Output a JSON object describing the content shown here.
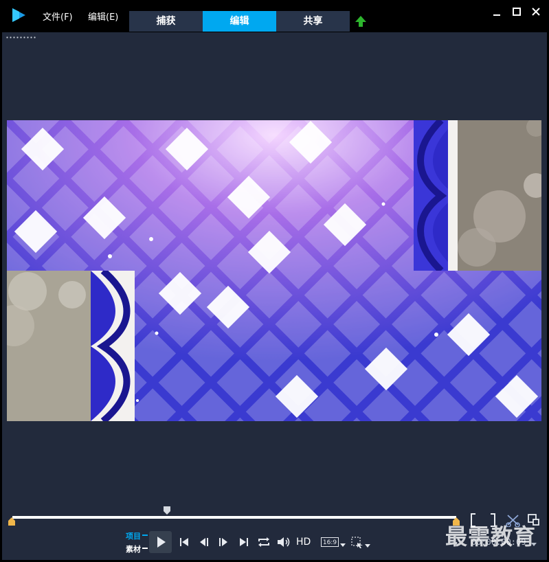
{
  "menu": {
    "file": "文件(F)",
    "edit": "编辑(E)"
  },
  "tabs": [
    {
      "label": "捕获",
      "active": false
    },
    {
      "label": "编辑",
      "active": true
    },
    {
      "label": "共享",
      "active": false
    }
  ],
  "controls": {
    "project_label": "项目",
    "clip_label": "素材",
    "hd_label": "HD",
    "aspect_ratio": "16:9",
    "timecode": "00:00:00:09"
  },
  "watermark": "最需教育",
  "colors": {
    "accent": "#00a8f0",
    "background": "#222a3c",
    "titlebar": "#000000",
    "tab_inactive": "#28344a",
    "upload_green": "#2db52d"
  },
  "icons": [
    "logo-icon",
    "upload-icon",
    "minimize-icon",
    "maximize-icon",
    "close-icon",
    "play-icon",
    "go-to-start-icon",
    "previous-frame-icon",
    "next-frame-icon",
    "go-to-end-icon",
    "repeat-icon",
    "volume-icon",
    "aspect-ratio-icon",
    "zoom-select-icon",
    "mark-in-out-icon",
    "split-clip-icon",
    "enlarge-icon"
  ]
}
